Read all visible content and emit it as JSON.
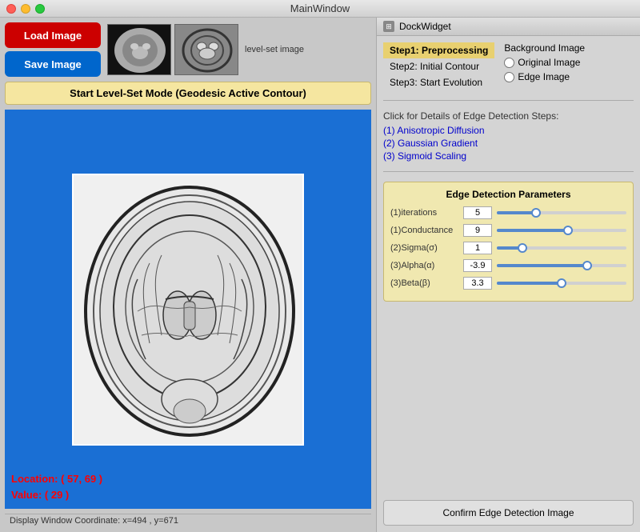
{
  "window": {
    "title": "MainWindow",
    "dock_title": "DockWidget"
  },
  "toolbar": {
    "load_label": "Load Image",
    "save_label": "Save Image",
    "levelset_label": "Start Level-Set Mode (Geodesic Active Contour)",
    "thumbnail_label": "level-set image"
  },
  "steps": [
    {
      "id": "step1",
      "label": "Step1: Preprocessing",
      "active": true
    },
    {
      "id": "step2",
      "label": "Step2: Initial Contour",
      "active": false
    },
    {
      "id": "step3",
      "label": "Step3: Start Evolution",
      "active": false
    }
  ],
  "background": {
    "title": "Background Image",
    "options": [
      {
        "id": "original",
        "label": "Original Image",
        "checked": false
      },
      {
        "id": "edge",
        "label": "Edge Image",
        "checked": false
      }
    ]
  },
  "edge_detection": {
    "prompt": "Click for Details of Edge Detection Steps:",
    "links": [
      "(1) Anisotropic Diffusion",
      "(2) Gaussian Gradient",
      "(3) Sigmoid Scaling"
    ]
  },
  "params": {
    "title": "Edge Detection Parameters",
    "rows": [
      {
        "label": "(1)iterations",
        "value": "5",
        "fill_pct": 30
      },
      {
        "label": "(1)Conductance",
        "value": "9",
        "fill_pct": 55
      },
      {
        "label": "(2)Sigma(σ)",
        "value": "1",
        "fill_pct": 20
      },
      {
        "label": "(3)Alpha(α)",
        "value": "-3.9",
        "fill_pct": 70
      },
      {
        "label": "(3)Beta(β)",
        "value": "3.3",
        "fill_pct": 50
      }
    ]
  },
  "location": {
    "location_label": "Location: ( 57, 69 )",
    "value_label": "Value: ( 29 )"
  },
  "status_bar": {
    "text": "Display Window Coordinate: x=494 , y=671"
  },
  "confirm_button": "Confirm Edge Detection Image"
}
